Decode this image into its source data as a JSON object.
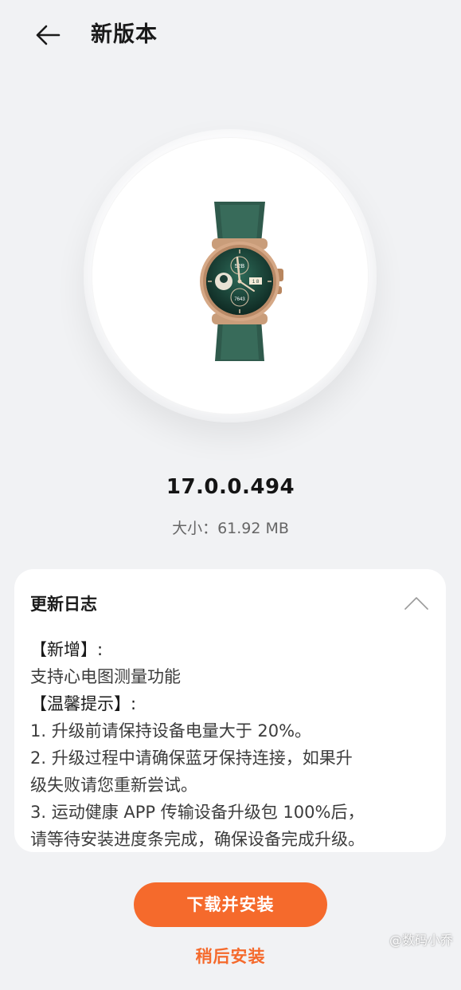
{
  "header": {
    "title": "新版本",
    "back_icon": "arrow-left-icon"
  },
  "hero": {
    "watch_face": {
      "top_complication": "52B",
      "date": "1 8",
      "bottom_complication": "7643"
    }
  },
  "version": "17.0.0.494",
  "size_label": "大小：61.92 MB",
  "changelog": {
    "title": "更新日志",
    "collapse_icon": "chevron-up-icon",
    "lines": [
      "【新增】:",
      "支持心电图测量功能",
      "【温馨提示】:",
      "1. 升级前请保持设备电量大于 20%。",
      "2. 升级过程中请确保蓝牙保持连接，如果升",
      "级失败请您重新尝试。",
      "3. 运动健康 APP 传输设备升级包 100%后，",
      "请等待安装进度条完成，确保设备完成升级。"
    ]
  },
  "primary_button": "下载并安装",
  "secondary_button": "稍后安装",
  "watermark": "@数码小乔",
  "colors": {
    "accent": "#f56a2c",
    "background": "#f1f2f4",
    "card": "#ffffff"
  }
}
